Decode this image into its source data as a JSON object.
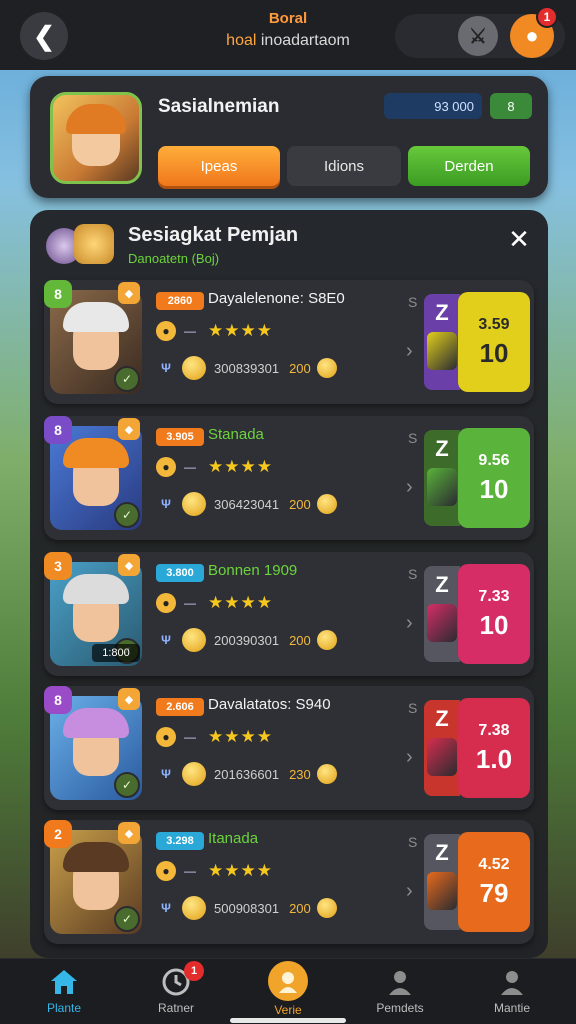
{
  "header": {
    "title": "Boral",
    "subtitle_hl": "hoal",
    "subtitle_rest": " inoadartaom",
    "back_icon": "back-arrow-icon",
    "notification_count": "1"
  },
  "profile": {
    "name": "Sasialnemian",
    "stat_value": "93  000",
    "stat_small": "8",
    "tabs": [
      "Ipeas",
      "Idions",
      "Derden"
    ],
    "colors": {
      "tab1": "#f0771c",
      "tab3": "#3b9c24"
    }
  },
  "panel": {
    "title": "Sesiagkat Pemjan",
    "subtitle": "Danoatetn (Boj)",
    "close": "✕"
  },
  "rows": [
    {
      "level": "2860",
      "level_color": "#f07a1c",
      "name": "Dayalelenone: S8E0",
      "name_green": false,
      "code": "300839301",
      "amount": "200",
      "stars": "★★★★",
      "badge": "8",
      "badge_color": "#63b83a",
      "side_letter": "S",
      "reward_num": "Z",
      "reward_left_color": "#6a3fa8",
      "reward_top": "3.59",
      "reward_bottom": "10",
      "reward_bg": "#e2cf1c",
      "reward_fg": "#2a2a2a",
      "hair": "#e8e8e8",
      "bg": "linear-gradient(135deg,#8a6a4a,#3a2a20)"
    },
    {
      "level": "3.905",
      "level_color": "#f07a1c",
      "name": "Stanada",
      "name_green": true,
      "code": "306423041",
      "amount": "200",
      "stars": "★★★★",
      "badge": "8",
      "badge_color": "#7a4cc8",
      "side_letter": "S",
      "reward_num": "Z",
      "reward_left_color": "#3d6b2a",
      "reward_top": "9.56",
      "reward_bottom": "10",
      "reward_bg": "#5ab33a",
      "reward_fg": "#ffffff",
      "hair": "#f08a22",
      "bg": "linear-gradient(135deg,#4a7ad6,#2a3a80)"
    },
    {
      "level": "3.800",
      "level_color": "#2aa8d8",
      "name": "Bonnen 1909",
      "name_green": true,
      "code": "200390301",
      "amount": "200",
      "stars": "★★★★",
      "badge": "3",
      "badge_color": "#f08a22",
      "overlay": "1:800",
      "side_letter": "S",
      "reward_num": "Z",
      "reward_left_color": "#555660",
      "reward_top": "7.33",
      "reward_bottom": "10",
      "reward_bg": "#d62d66",
      "reward_fg": "#ffffff",
      "hair": "#dcdcdc",
      "bg": "linear-gradient(135deg,#4aa0c8,#2a5a70)"
    },
    {
      "level": "2.606",
      "level_color": "#f07a1c",
      "name": "Davalatatos: S940",
      "name_green": false,
      "code": "201636601",
      "amount": "230",
      "stars": "★★★★",
      "badge": "8",
      "badge_color": "#9a4cc8",
      "side_letter": "S",
      "reward_num": "Z",
      "reward_left_color": "#c8352d",
      "reward_top": "7.38",
      "reward_bottom": "1.0",
      "reward_bg": "#d62d4e",
      "reward_fg": "#ffffff",
      "hair": "#c78ee0",
      "bg": "linear-gradient(135deg,#6ab0e8,#2a5aa0)"
    },
    {
      "level": "3.298",
      "level_color": "#2aa8d8",
      "name": "Itanada",
      "name_green": true,
      "code": "500908301",
      "amount": "200",
      "stars": "★★★★",
      "badge": "2",
      "badge_color": "#f07a1c",
      "side_letter": "S",
      "reward_num": "Z",
      "reward_left_color": "#555660",
      "reward_top": "4.52",
      "reward_bottom": "79",
      "reward_bg": "#e86a1c",
      "reward_fg": "#ffffff",
      "hair": "#5a3a22",
      "bg": "linear-gradient(135deg,#c8a04a,#5a3a22)"
    }
  ],
  "nav": {
    "items": [
      {
        "label": "Plante",
        "icon": "home-icon",
        "color": "#35b7e8"
      },
      {
        "label": "Ratner",
        "icon": "timer-icon",
        "color": "#bdbdbd",
        "badge": "1"
      },
      {
        "label": "Verie",
        "icon": "hero-icon",
        "color": "#f0a42a"
      },
      {
        "label": "Pemdets",
        "icon": "person-icon",
        "color": "#bdbdbd"
      },
      {
        "label": "Mantie",
        "icon": "person-icon",
        "color": "#bdbdbd"
      }
    ]
  }
}
